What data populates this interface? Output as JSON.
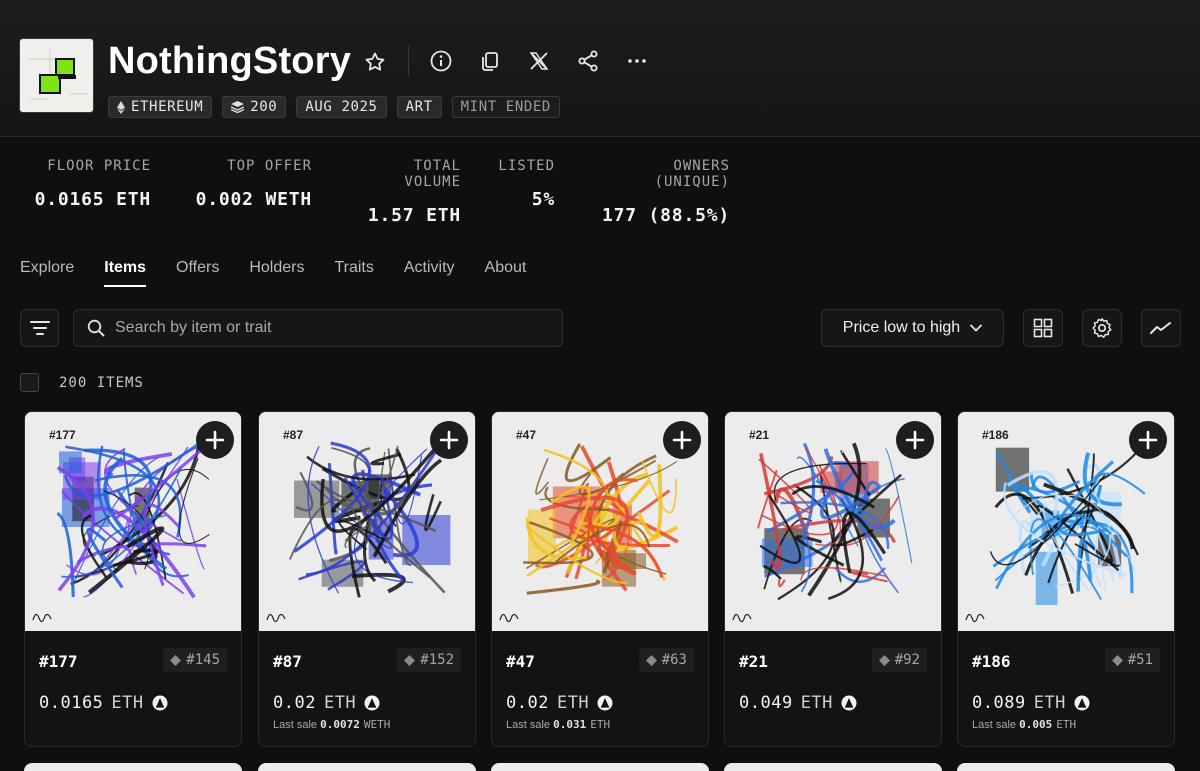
{
  "collection": {
    "name": "NothingStory",
    "tags": [
      {
        "label": "ETHEREUM",
        "icon": "ethereum-icon"
      },
      {
        "label": "200",
        "icon": "layers-icon"
      },
      {
        "label": "AUG 2025"
      },
      {
        "label": "ART"
      },
      {
        "label": "MINT ENDED",
        "muted": true
      }
    ]
  },
  "stats": [
    {
      "label": "FLOOR PRICE",
      "value": "0.0165 ETH"
    },
    {
      "label": "TOP OFFER",
      "value": "0.002 WETH"
    },
    {
      "label": "TOTAL VOLUME",
      "value": "1.57 ETH"
    },
    {
      "label": "LISTED",
      "value": "5%"
    },
    {
      "label": "OWNERS (UNIQUE)",
      "value": "177 (88.5%)"
    }
  ],
  "tabs": [
    "Explore",
    "Items",
    "Offers",
    "Holders",
    "Traits",
    "Activity",
    "About"
  ],
  "active_tab": "Items",
  "search": {
    "placeholder": "Search by item or trait"
  },
  "sort": {
    "label": "Price low to high"
  },
  "item_count": "200 ITEMS",
  "items": [
    {
      "label": "#177",
      "name": "#177",
      "rank": "#145",
      "price": "0.0165",
      "unit": "ETH",
      "last_sale": "",
      "last_sale_value": "",
      "last_sale_unit": "",
      "palette": [
        "#7b3ff2",
        "#1e5fd8",
        "#111111"
      ]
    },
    {
      "label": "#87",
      "name": "#87",
      "rank": "#152",
      "price": "0.02",
      "unit": "ETH",
      "last_sale": "Last sale",
      "last_sale_value": "0.0072",
      "last_sale_unit": "WETH",
      "palette": [
        "#111111",
        "#555555",
        "#2a3bd6"
      ]
    },
    {
      "label": "#47",
      "name": "#47",
      "rank": "#63",
      "price": "0.02",
      "unit": "ETH",
      "last_sale": "Last sale",
      "last_sale_value": "0.031",
      "last_sale_unit": "ETH",
      "palette": [
        "#e84a2c",
        "#f2c21b",
        "#8a5a20"
      ]
    },
    {
      "label": "#21",
      "name": "#21",
      "rank": "#92",
      "price": "0.049",
      "unit": "ETH",
      "last_sale": "",
      "last_sale_value": "",
      "last_sale_unit": "",
      "palette": [
        "#111111",
        "#2f6fe0",
        "#d23b3b"
      ]
    },
    {
      "label": "#186",
      "name": "#186",
      "rank": "#51",
      "price": "0.089",
      "unit": "ETH",
      "last_sale": "Last sale",
      "last_sale_value": "0.005",
      "last_sale_unit": "ETH",
      "palette": [
        "#1f8ae6",
        "#0d0d0d",
        "#bfe0ff"
      ]
    }
  ],
  "colors": {
    "accent": "#ffffff",
    "logo_green": "#7fe31a",
    "background": "#0f0f10"
  }
}
